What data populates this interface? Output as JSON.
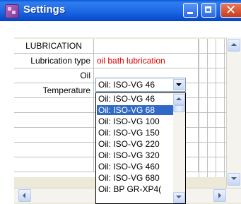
{
  "window": {
    "title": "Settings"
  },
  "rows": [
    {
      "label": "LUBRICATION",
      "value": ""
    },
    {
      "label": "Lubrication type",
      "value": "oil bath lubrication"
    },
    {
      "label": "Oil",
      "value": "Oil: ISO-VG 46"
    },
    {
      "label": "Temperature",
      "value": ""
    }
  ],
  "dropdown": {
    "selected_index": 1,
    "options": [
      "Oil: ISO-VG 46",
      "Oil: ISO-VG 68",
      "Oil: ISO-VG 100",
      "Oil: ISO-VG 150",
      "Oil: ISO-VG 220",
      "Oil: ISO-VG 320",
      "Oil: ISO-VG 460",
      "Oil: ISO-VG 680",
      "Oil: BP GR-XP4("
    ]
  },
  "colors": {
    "titlebar": "#1f6ae6",
    "selection": "#316ac5",
    "value_red": "#e00000"
  }
}
